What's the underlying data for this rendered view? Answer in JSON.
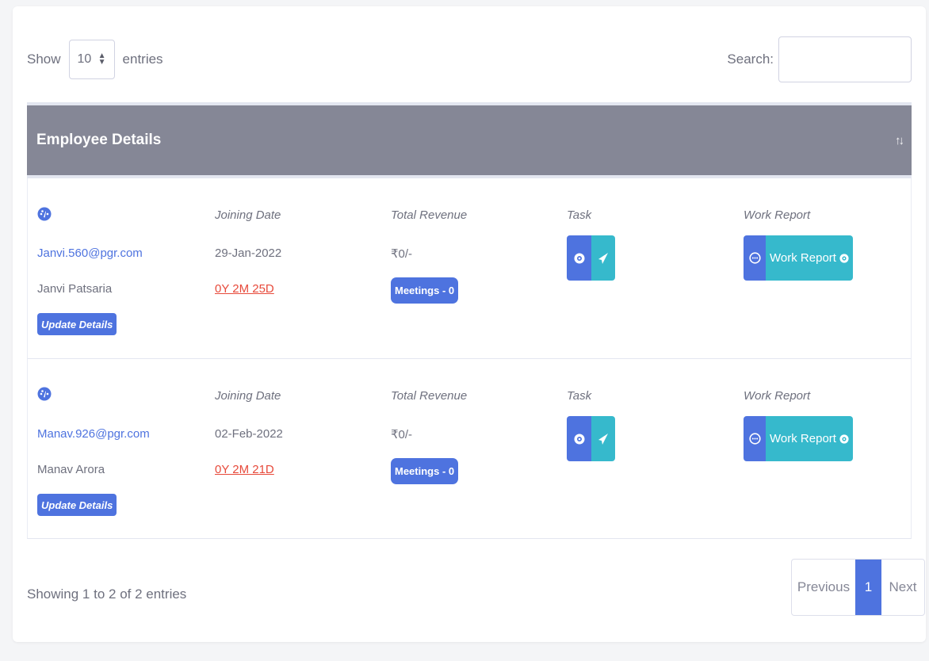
{
  "controls": {
    "show_label": "Show",
    "page_length": "10",
    "entries_label": "entries",
    "search_label": "Search:",
    "search_value": ""
  },
  "table": {
    "header_title": "Employee Details",
    "rows": [
      {
        "email": "Janvi.560@pgr.com",
        "name": "Janvi Patsaria",
        "update_label": "Update Details",
        "joining_label": "Joining Date",
        "joining_date": "29-Jan-2022",
        "duration": "0Y 2M 25D",
        "revenue_label": "Total Revenue",
        "revenue": "₹0/-",
        "meetings": "Meetings - 0",
        "task_label": "Task",
        "work_report_label": "Work Report",
        "work_report_button": "Work Report"
      },
      {
        "email": "Manav.926@pgr.com",
        "name": "Manav Arora",
        "update_label": "Update Details",
        "joining_label": "Joining Date",
        "joining_date": "02-Feb-2022",
        "duration": "0Y 2M 21D",
        "revenue_label": "Total Revenue",
        "revenue": "₹0/-",
        "meetings": "Meetings - 0",
        "task_label": "Task",
        "work_report_label": "Work Report",
        "work_report_button": "Work Report"
      }
    ]
  },
  "footer": {
    "info": "Showing 1 to 2 of 2 entries",
    "previous": "Previous",
    "current_page": "1",
    "next": "Next"
  },
  "icons": {
    "row_icon": "dashboard-gauge-icon",
    "task_view": "eye-icon",
    "task_assign": "paper-plane-icon",
    "report_chat": "comment-dots-icon",
    "report_view": "eye-icon",
    "sort": "sort-arrows-icon"
  },
  "colors": {
    "primary": "#4e73df",
    "info": "#36b9cc",
    "danger": "#e74a3b",
    "header_bg": "#858796"
  }
}
